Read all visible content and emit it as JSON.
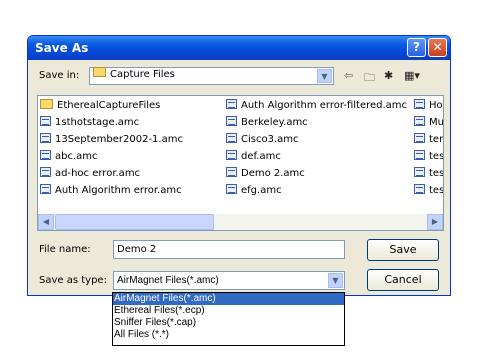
{
  "window": {
    "title": "Save As",
    "help": "?",
    "close": "✕"
  },
  "save_in": {
    "label": "Save in:",
    "value": "Capture Files"
  },
  "files": {
    "col1": [
      {
        "name": "EtherealCaptureFiles",
        "type": "folder"
      },
      {
        "name": "1sthotstage.amc",
        "type": "file"
      },
      {
        "name": "13September2002-1.amc",
        "type": "file"
      },
      {
        "name": "abc.amc",
        "type": "file"
      },
      {
        "name": "ad-hoc error.amc",
        "type": "file"
      },
      {
        "name": "Auth Algorithm error.amc",
        "type": "file"
      }
    ],
    "col2": [
      {
        "name": "Auth Algorithm error-filtered.amc",
        "type": "file"
      },
      {
        "name": "Berkeley.amc",
        "type": "file"
      },
      {
        "name": "Cisco3.amc",
        "type": "file"
      },
      {
        "name": "def.amc",
        "type": "file"
      },
      {
        "name": "Demo 2.amc",
        "type": "file"
      },
      {
        "name": "efg.amc",
        "type": "file"
      }
    ],
    "col3": [
      {
        "name": "Ho",
        "type": "file"
      },
      {
        "name": "Mu",
        "type": "file"
      },
      {
        "name": "ter",
        "type": "file"
      },
      {
        "name": "tes",
        "type": "file"
      },
      {
        "name": "tes",
        "type": "file"
      },
      {
        "name": "tes",
        "type": "file"
      }
    ]
  },
  "file_name": {
    "label": "File name:",
    "value": "Demo 2"
  },
  "save_as_type": {
    "label": "Save as type:",
    "value": "AirMagnet Files(*.amc)"
  },
  "buttons": {
    "save": "Save",
    "cancel": "Cancel"
  },
  "type_options": [
    "AirMagnet Files(*.amc)",
    "Ethereal Files(*.ecp)",
    "Sniffer Files(*.cap)",
    "All Files (*.*)"
  ]
}
